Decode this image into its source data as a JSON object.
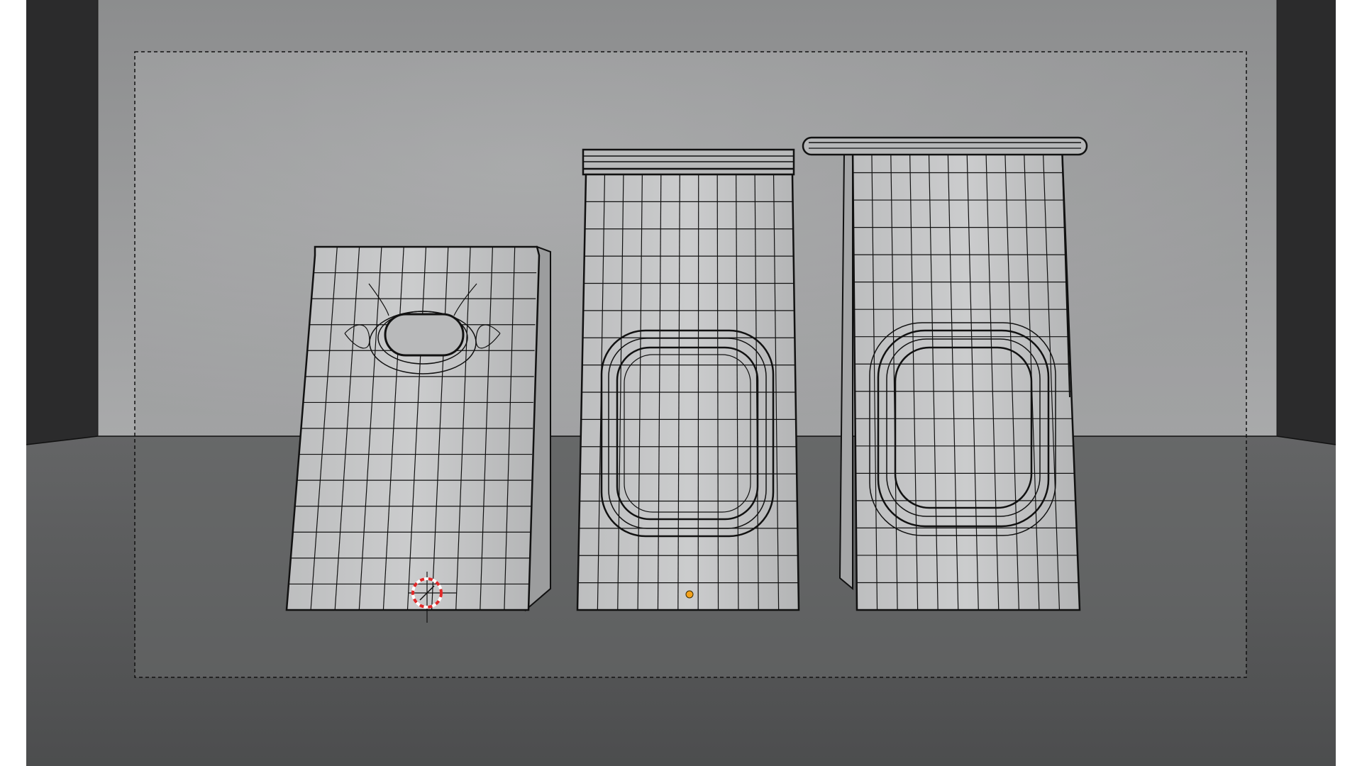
{
  "viewport": {
    "name": "3d-viewport",
    "mode": "edit-mode-wireframe-overlay",
    "camera_frame": "dashed-camera-bounds",
    "colors": {
      "page": "#ffffff",
      "viewport_outer": "#2d2d2d",
      "wall_top": "#8f9091",
      "wall_mid": "#a7a8a9",
      "floor": "#5f6061",
      "floor_front": "#4a4b4c",
      "mesh_fill": "#c6c7c8",
      "mesh_shade": "#a9aaab",
      "wire": "#111111",
      "origin_point": "#f4a21c",
      "cursor_ring_red": "#e02828",
      "cursor_ring_white": "#ffffff"
    }
  },
  "objects": [
    {
      "name": "paper-bag-small-handle"
    },
    {
      "name": "paper-bag-tall-window"
    },
    {
      "name": "paper-bag-tall-window-lid"
    }
  ],
  "markers": {
    "cursor": "3d-cursor-icon",
    "origin": "origin-dot"
  }
}
